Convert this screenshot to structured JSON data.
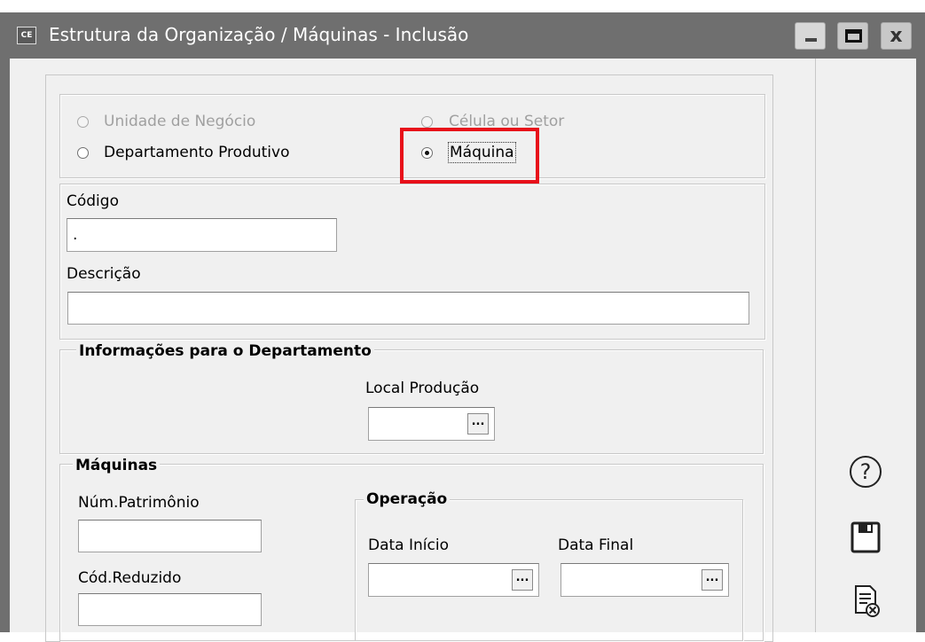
{
  "window": {
    "app_icon": "CE",
    "title": "Estrutura da Organização / Máquinas - Inclusão",
    "controls": {
      "minimize": "minimize-icon",
      "maximize": "maximize-icon",
      "close": "x"
    }
  },
  "type_selector": {
    "options": [
      {
        "label": "Unidade de Negócio",
        "enabled": false,
        "checked": false
      },
      {
        "label": "Departamento Produtivo",
        "enabled": true,
        "checked": false
      },
      {
        "label": "Célula ou Setor",
        "enabled": false,
        "checked": false
      },
      {
        "label": "Máquina",
        "enabled": true,
        "checked": true
      }
    ]
  },
  "codigo": {
    "label": "Código",
    "value": "."
  },
  "descricao": {
    "label": "Descrição",
    "value": ""
  },
  "dept_info": {
    "title": "Informações para o Departamento",
    "local_producao": {
      "label": "Local Produção",
      "value": "",
      "button": "..."
    }
  },
  "maquinas": {
    "title": "Máquinas",
    "num_patrimonio": {
      "label": "Núm.Patrimônio",
      "value": ""
    },
    "cod_reduzido": {
      "label": "Cód.Reduzido",
      "value": ""
    }
  },
  "operacao": {
    "title": "Operação",
    "data_inicio": {
      "label": "Data Início",
      "value": "",
      "button": "..."
    },
    "data_final": {
      "label": "Data Final",
      "value": "",
      "button": "..."
    }
  },
  "side_buttons": {
    "help": "?",
    "icons": [
      "help-icon",
      "save-icon",
      "cancel-document-icon"
    ]
  },
  "colors": {
    "titlebar": "#6f6f6f",
    "client_bg": "#f0f0f0",
    "highlight": "#e8101a"
  }
}
